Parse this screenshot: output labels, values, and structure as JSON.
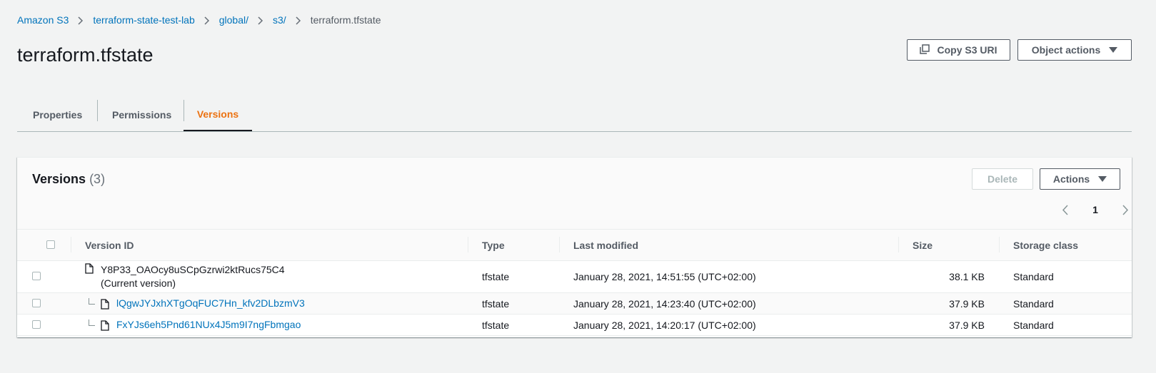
{
  "breadcrumb": {
    "items": [
      "Amazon S3",
      "terraform-state-test-lab",
      "global/",
      "s3/"
    ],
    "current": "terraform.tfstate"
  },
  "page": {
    "title": "terraform.tfstate"
  },
  "header_buttons": {
    "copy_uri": "Copy S3 URI",
    "object_actions": "Object actions"
  },
  "tabs": [
    {
      "label": "Properties",
      "active": false
    },
    {
      "label": "Permissions",
      "active": false
    },
    {
      "label": "Versions",
      "active": true
    }
  ],
  "versions_panel": {
    "title": "Versions",
    "count": "(3)",
    "delete_label": "Delete",
    "actions_label": "Actions",
    "page": "1",
    "columns": [
      "Version ID",
      "Type",
      "Last modified",
      "Size",
      "Storage class"
    ],
    "rows": [
      {
        "version_id": "Y8P33_OAOcy8uSCpGzrwi2ktRucs75C4",
        "note": "(Current version)",
        "type": "tfstate",
        "last_modified": "January 28, 2021, 14:51:55 (UTC+02:00)",
        "size": "38.1 KB",
        "storage_class": "Standard"
      },
      {
        "version_id": "lQgwJYJxhXTgOqFUC7Hn_kfv2DLbzmV3",
        "type": "tfstate",
        "last_modified": "January 28, 2021, 14:23:40 (UTC+02:00)",
        "size": "37.9 KB",
        "storage_class": "Standard"
      },
      {
        "version_id": "FxYJs6eh5Pnd61NUx4J5m9I7ngFbmgao",
        "type": "tfstate",
        "last_modified": "January 28, 2021, 14:20:17 (UTC+02:00)",
        "size": "37.9 KB",
        "storage_class": "Standard"
      }
    ]
  },
  "colors": {
    "link": "#0073bb",
    "active_tab": "#ec7211",
    "background": "#f2f3f3"
  }
}
